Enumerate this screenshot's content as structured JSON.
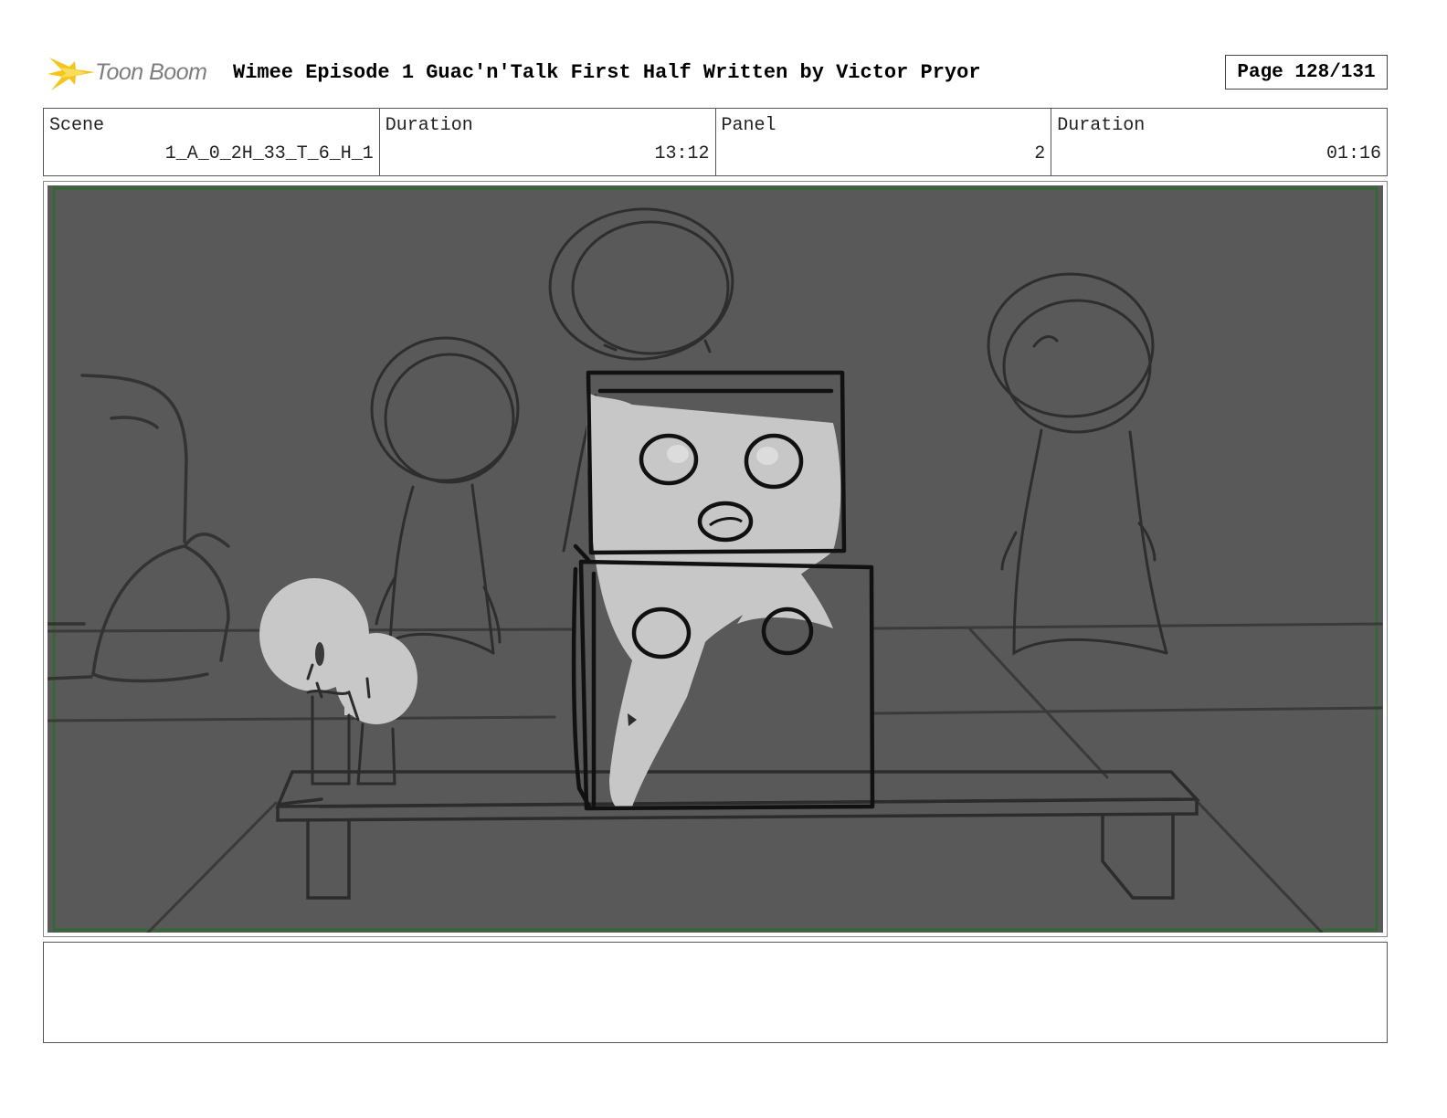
{
  "header": {
    "logo_text": "Toon Boom",
    "title": "Wimee Episode 1 Guac'n'Talk First Half  Written by Victor Pryor",
    "page": "Page 128/131"
  },
  "info": {
    "scene_label": "Scene",
    "scene_value": "1_A_0_2H_33_T_6_H_1",
    "duration_label": "Duration",
    "duration_value": "13:12",
    "panel_label": "Panel",
    "panel_value": "2",
    "panel_duration_label": "Duration",
    "panel_duration_value": "01:16"
  },
  "colors": {
    "panel_background": "#595959",
    "panel_border": "#2e6b2e",
    "logo_star": "#f5c518"
  },
  "notes": ""
}
